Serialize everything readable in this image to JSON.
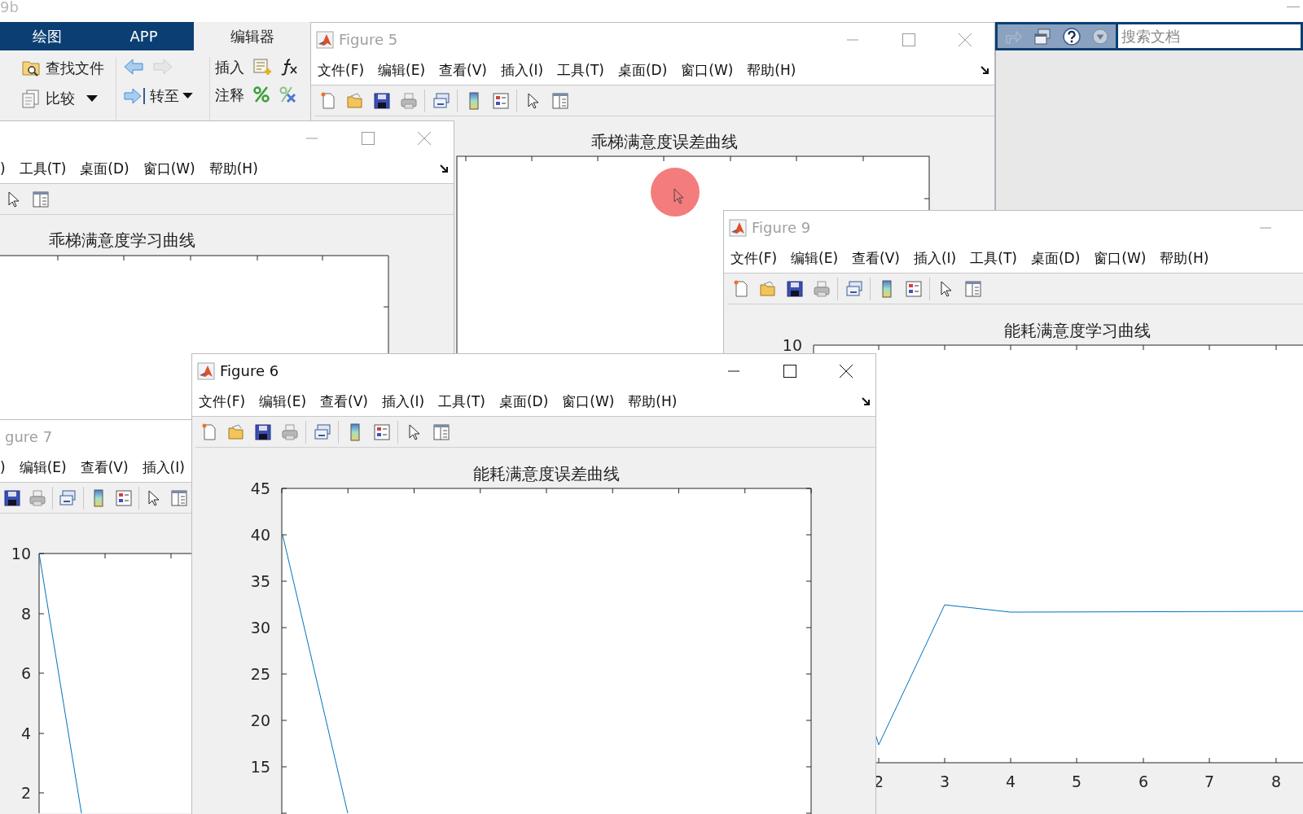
{
  "matlab": {
    "version_fragment": "9b",
    "tabs": [
      {
        "label": "绘图",
        "selected": false
      },
      {
        "label": "APP",
        "selected": false
      },
      {
        "label": "编辑器",
        "selected": true
      }
    ],
    "ribbon": {
      "find_files": "查找文件",
      "compare": "比较",
      "goto": "转至",
      "insert": "插入",
      "comment": "注释"
    },
    "search": {
      "placeholder": "搜索文档"
    }
  },
  "figures": [
    {
      "title": "Figure 5",
      "active": false,
      "menu": [
        "文件(F)",
        "编辑(E)",
        "查看(V)",
        "插入(I)",
        "工具(T)",
        "桌面(D)",
        "窗口(W)",
        "帮助(H)"
      ],
      "plot_title": "乖梯满意度误差曲线"
    },
    {
      "menu": [
        ")",
        "工具(T)",
        "桌面(D)",
        "窗口(W)",
        "帮助(H)"
      ],
      "plot_title": "乖梯满意度学习曲线"
    },
    {
      "title": "gure 7",
      "active": false,
      "menu": [
        ")",
        "编辑(E)",
        "查看(V)",
        "插入(I)"
      ],
      "y_ticks": [
        "10",
        "8",
        "6",
        "4",
        "2"
      ]
    },
    {
      "title": "Figure 9",
      "active": false,
      "menu": [
        "文件(F)",
        "编辑(E)",
        "查看(V)",
        "插入(I)",
        "工具(T)",
        "桌面(D)",
        "窗口(W)",
        "帮助(H)"
      ],
      "plot_title": "能耗满意度学习曲线",
      "y_ticks": [
        "10"
      ],
      "x_ticks": [
        "2",
        "3",
        "4",
        "5",
        "6",
        "7",
        "8"
      ]
    },
    {
      "title": "Figure 6",
      "active": true,
      "menu": [
        "文件(F)",
        "编辑(E)",
        "查看(V)",
        "插入(I)",
        "工具(T)",
        "桌面(D)",
        "窗口(W)",
        "帮助(H)"
      ],
      "plot_title": "能耗满意度误差曲线",
      "y_ticks": [
        "45",
        "40",
        "35",
        "30",
        "25",
        "20",
        "15"
      ]
    }
  ]
}
